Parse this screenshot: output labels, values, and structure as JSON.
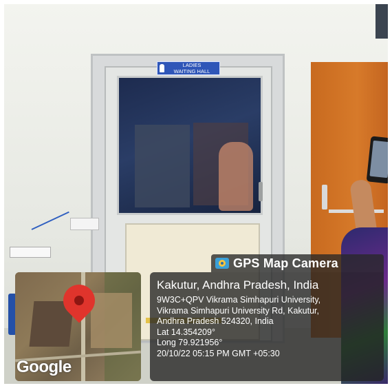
{
  "sign": {
    "line1": "LADIES",
    "line2": "WAITING HALL"
  },
  "overlay": {
    "app_name": "GPS Map Camera",
    "place": "Kakutur, Andhra Pradesh, India",
    "address_line1": "9W3C+QPV Vikrama Simhapuri University,",
    "address_line2": "Vikrama Simhapuri University Rd, Kakutur,",
    "address_line3": "Andhra Pradesh 524320, India",
    "lat": "Lat 14.354209°",
    "long": "Long 79.921956°",
    "timestamp": "20/10/22 05:15 PM GMT +05:30"
  },
  "map": {
    "attribution": "Google",
    "pin_color": "#e0342c"
  },
  "colors": {
    "overlay_bg": "#232323",
    "sign_bg": "#2f56b8",
    "door_orange": "#d77a2a"
  },
  "icons": [
    "camera-icon",
    "map-pin-icon",
    "woman-icon"
  ]
}
